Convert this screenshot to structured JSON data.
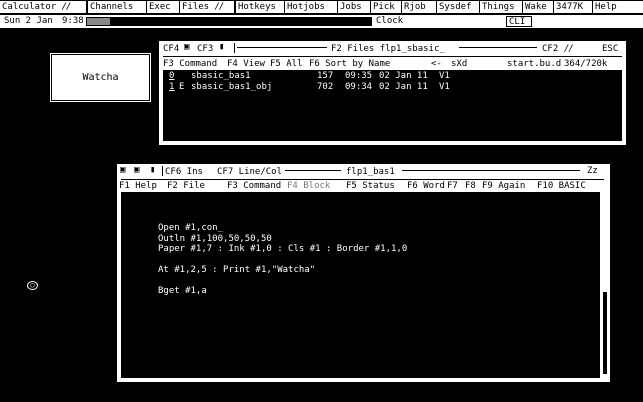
{
  "menubar": {
    "items": [
      {
        "label": "Calculator",
        "slash": true
      },
      {
        "label": "Channels",
        "slash": false
      },
      {
        "label": "Exec",
        "slash": false
      },
      {
        "label": "Files",
        "slash": true
      },
      {
        "label": "Hotkeys",
        "slash": false
      },
      {
        "label": "Hotjobs",
        "slash": false
      },
      {
        "label": "Jobs",
        "slash": false
      },
      {
        "label": "Pick",
        "slash": false
      },
      {
        "label": "Rjob",
        "slash": false
      },
      {
        "label": "Sysdef",
        "slash": false
      },
      {
        "label": "Things",
        "slash": false
      },
      {
        "label": "Wake",
        "slash": false
      },
      {
        "label": "3477K",
        "slash": false
      },
      {
        "label": "Help",
        "slash": false
      }
    ],
    "slash_glyph": "//"
  },
  "statusbar": {
    "date": "Sun  2 Jan",
    "time": "9:38",
    "clock_label": "Clock",
    "cli_label": "CLI",
    "progress_fraction": 0.08
  },
  "watcha": {
    "text": "Watcha"
  },
  "files_window": {
    "title": "F2 Files flp1_sbasic_",
    "tab_f4": "CF4",
    "tab_f3": "CF3",
    "tab_f2": "CF2",
    "esc": "ESC",
    "toolbar": {
      "command": "F3 Command",
      "view": "F4 View",
      "all": "F5 All",
      "sort": "F6 Sort by Name",
      "arrow": "<-",
      "sxd": "sXd",
      "path": "start.bu.d",
      "space": "364/720k"
    },
    "rows": [
      {
        "idx": "0",
        "flag": "",
        "name": "sbasic_bas1",
        "size": "157",
        "time": "09:35",
        "date": "02 Jan 11",
        "ver": "V1"
      },
      {
        "idx": "1",
        "flag": "E",
        "name": "sbasic_bas1_obj",
        "size": "702",
        "time": "09:34",
        "date": "02 Jan 11",
        "ver": "V1"
      }
    ]
  },
  "editor_window": {
    "tab_ins": "CF6 Ins",
    "tab_line": "CF7 Line/Col",
    "filename": "flp1_bas1",
    "zz": "Zz",
    "fkeys": {
      "help": "F1 Help",
      "file": "F2 File",
      "command": "F3 Command",
      "block": "F4 Block",
      "status": "F5 Status",
      "word": "F6 Word",
      "f7": "F7",
      "f8": "F8",
      "again": "F9 Again",
      "basic": "F10 BASIC"
    },
    "code": [
      "Open #1,con_",
      "Outln #1,100,50,50,50",
      "Paper #1,7 : Ink #1,0 : Cls #1 : Border #1,1,0",
      "",
      "At #1,2,5 : Print #1,\"Watcha\"",
      "",
      "Bget #1,a"
    ]
  },
  "pointer": {
    "glyph": "○"
  }
}
